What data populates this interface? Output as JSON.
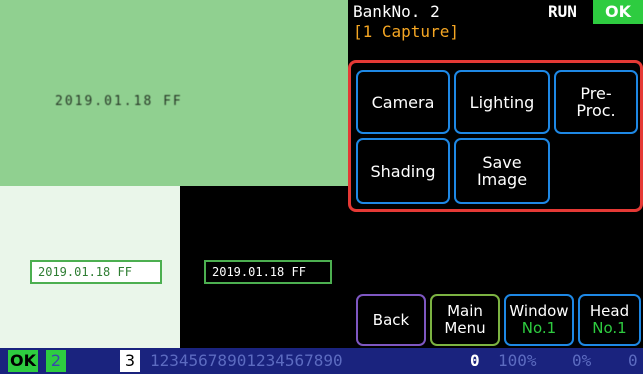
{
  "image_view": {
    "blurred_timestamp": "2019.01.18 FF",
    "date_left": "2019.01.18 FF",
    "date_right": "2019.01.18 FF"
  },
  "header": {
    "bank": "BankNo. 2",
    "run": "RUN",
    "ok": "OK",
    "capture": "[1 Capture]"
  },
  "menu": {
    "camera": "Camera",
    "lighting": "Lighting",
    "pre_proc_1": "Pre-",
    "pre_proc_2": "Proc.",
    "shading": "Shading",
    "save_image_1": "Save",
    "save_image_2": "Image"
  },
  "nav": {
    "back": "Back",
    "main_menu_1": "Main",
    "main_menu_2": "Menu",
    "window": "Window",
    "window_sub": "No.1",
    "head": "Head",
    "head_sub": "No.1"
  },
  "status_bar": {
    "ok": "OK",
    "slot2": "2",
    "slot3": "3",
    "digits": "12345678901234567890",
    "value": "0",
    "pct1": "100%",
    "pct2": "0%",
    "last": "0"
  },
  "colors": {
    "accent_green": "#2ecc40",
    "button_border_blue": "#1e88e5",
    "frame_red": "#e53935",
    "capture_orange": "#f5a623"
  }
}
